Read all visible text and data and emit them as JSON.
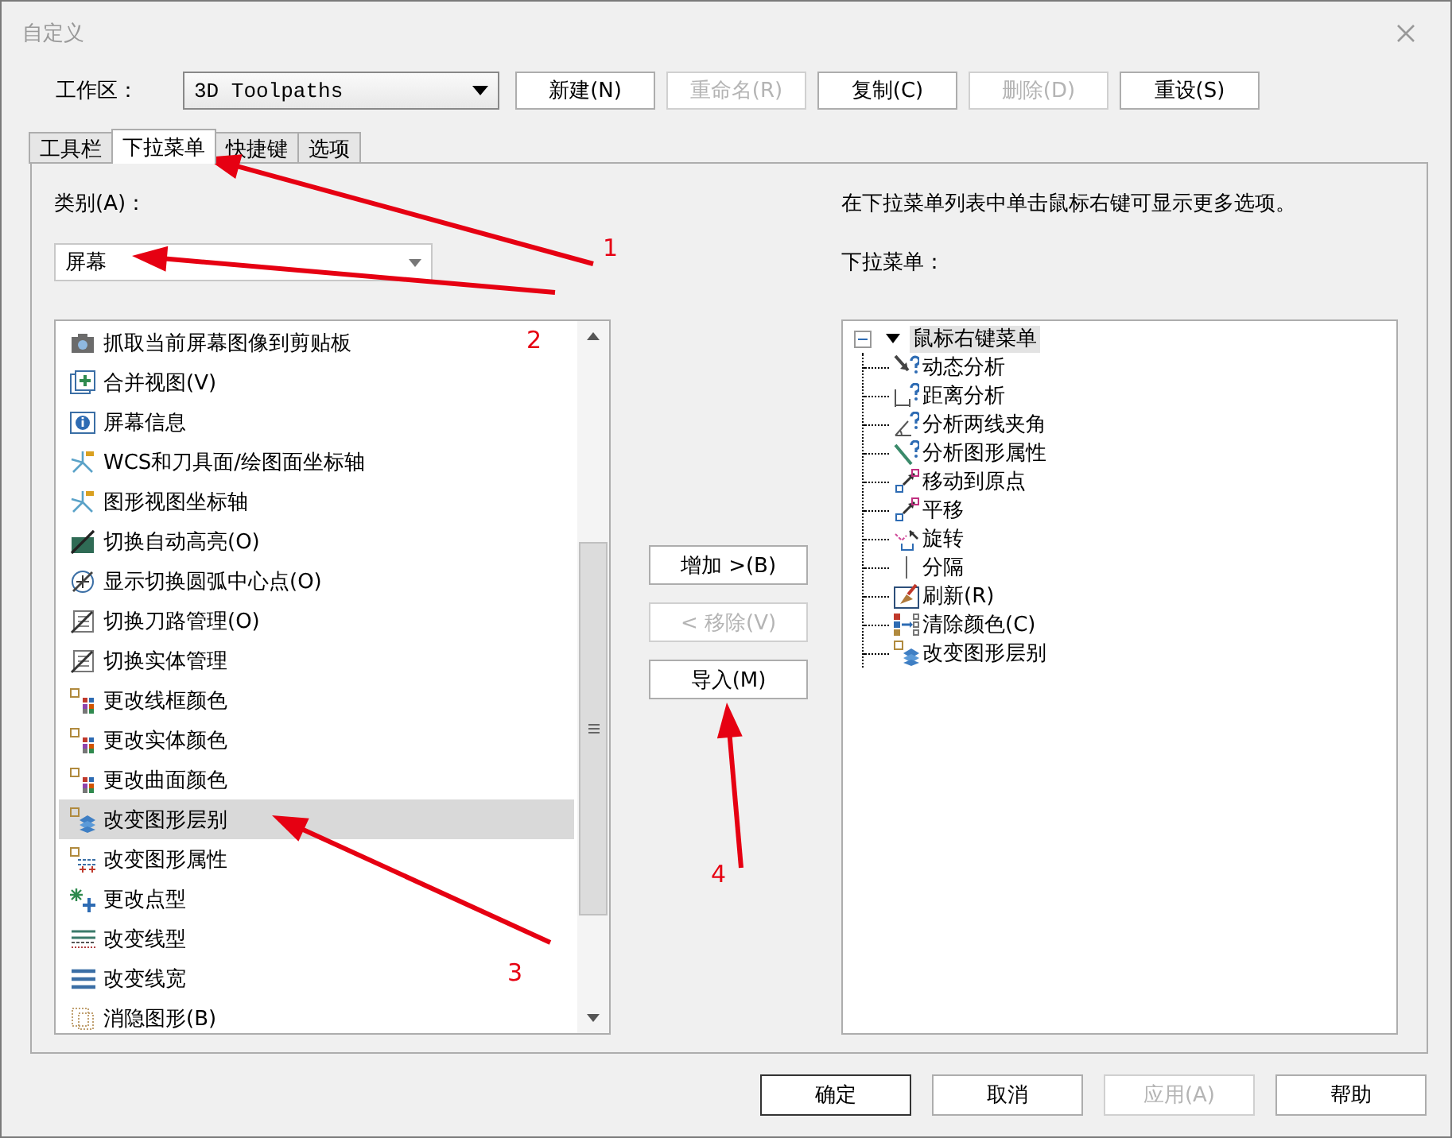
{
  "window": {
    "title": "自定义"
  },
  "workspace": {
    "label": "工作区：",
    "value": "3D Toolpaths"
  },
  "workspace_buttons": [
    {
      "label": "新建(N)",
      "disabled": false
    },
    {
      "label": "重命名(R)",
      "disabled": true
    },
    {
      "label": "复制(C)",
      "disabled": false
    },
    {
      "label": "删除(D)",
      "disabled": true
    },
    {
      "label": "重设(S)",
      "disabled": false
    }
  ],
  "tabs": [
    {
      "label": "工具栏",
      "selected": false
    },
    {
      "label": "下拉菜单",
      "selected": true
    },
    {
      "label": "快捷键",
      "selected": false
    },
    {
      "label": "选项",
      "selected": false
    }
  ],
  "category": {
    "label": "类别(A)：",
    "value": "屏幕"
  },
  "commands": [
    {
      "label": "抓取当前屏幕图像到剪贴板",
      "selected": false
    },
    {
      "label": "合并视图(V)",
      "selected": false
    },
    {
      "label": "屏幕信息",
      "selected": false
    },
    {
      "label": "WCS和刀具面/绘图面坐标轴",
      "selected": false
    },
    {
      "label": "图形视图坐标轴",
      "selected": false
    },
    {
      "label": "切换自动高亮(O)",
      "selected": false
    },
    {
      "label": "显示切换圆弧中心点(O)",
      "selected": false
    },
    {
      "label": "切换刀路管理(O)",
      "selected": false
    },
    {
      "label": "切换实体管理",
      "selected": false
    },
    {
      "label": "更改线框颜色",
      "selected": false
    },
    {
      "label": "更改实体颜色",
      "selected": false
    },
    {
      "label": "更改曲面颜色",
      "selected": false
    },
    {
      "label": "改变图形层别",
      "selected": true
    },
    {
      "label": "改变图形属性",
      "selected": false
    },
    {
      "label": "更改点型",
      "selected": false
    },
    {
      "label": "改变线型",
      "selected": false
    },
    {
      "label": "改变线宽",
      "selected": false
    },
    {
      "label": "消隐图形(B)",
      "selected": false
    }
  ],
  "transfer_buttons": [
    {
      "label": "增加 >(B)",
      "disabled": false
    },
    {
      "label": "< 移除(V)",
      "disabled": true
    },
    {
      "label": "导入(M)",
      "disabled": false
    }
  ],
  "hint": "在下拉菜单列表中单击鼠标右键可显示更多选项。",
  "menu_label": "下拉菜单：",
  "menu_tree": {
    "label": "鼠标右键菜单",
    "expanded": true,
    "selected": true,
    "children": [
      {
        "label": "动态分析",
        "selected": false
      },
      {
        "label": "距离分析",
        "selected": false
      },
      {
        "label": "分析两线夹角",
        "selected": false
      },
      {
        "label": "分析图形属性",
        "selected": false
      },
      {
        "label": "移动到原点",
        "selected": false
      },
      {
        "label": "平移",
        "selected": false
      },
      {
        "label": "旋转",
        "selected": false
      },
      {
        "label": "分隔",
        "selected": false
      },
      {
        "label": "刷新(R)",
        "selected": false
      },
      {
        "label": "清除颜色(C)",
        "selected": false
      },
      {
        "label": "改变图形层别",
        "selected": false
      }
    ]
  },
  "dialog_buttons": [
    {
      "label": "确定",
      "default": true,
      "disabled": false
    },
    {
      "label": "取消",
      "default": false,
      "disabled": false
    },
    {
      "label": "应用(A)",
      "default": false,
      "disabled": true
    },
    {
      "label": "帮助",
      "default": false,
      "disabled": false
    }
  ],
  "annotations": [
    "1",
    "2",
    "3",
    "4"
  ]
}
